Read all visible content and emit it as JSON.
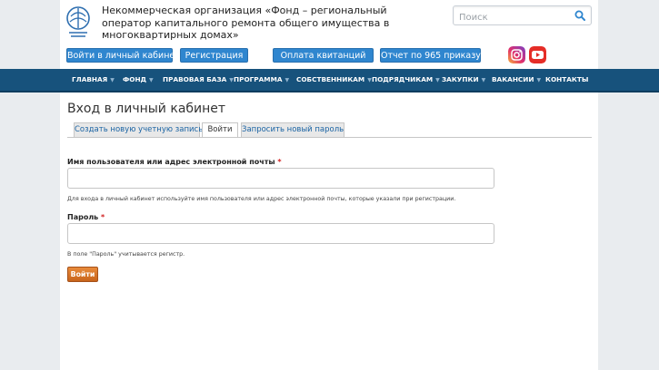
{
  "header": {
    "org_title": "Некоммерческая организация «Фонд – региональный оператор капитального ремонта общего имущества в многоквартирных домах»",
    "search_placeholder": "Поиск",
    "buttons": {
      "cabinet": "Войти в личный кабинет",
      "register": "Регистрация",
      "receipts": "Оплата квитанций",
      "report": "Отчет по 965 приказу"
    },
    "social_icons": [
      "instagram-icon",
      "youtube-icon"
    ]
  },
  "nav": {
    "items": [
      {
        "label": "ГЛАВНАЯ",
        "dropdown": true
      },
      {
        "label": "ФОНД",
        "dropdown": true
      },
      {
        "label": "ПРАВОВАЯ БАЗА",
        "dropdown": true
      },
      {
        "label": "ПРОГРАММА",
        "dropdown": true
      },
      {
        "label": "СОБСТВЕННИКАМ",
        "dropdown": true
      },
      {
        "label": "ПОДРЯДЧИКАМ",
        "dropdown": true
      },
      {
        "label": "ЗАКУПКИ",
        "dropdown": true
      },
      {
        "label": "ВАКАНСИИ",
        "dropdown": true
      },
      {
        "label": "КОНТАКТЫ",
        "dropdown": false
      }
    ]
  },
  "main": {
    "heading": "Вход в личный кабинет",
    "tabs": [
      {
        "label": "Создать новую учетную запись",
        "active": false
      },
      {
        "label": "Войти",
        "active": true
      },
      {
        "label": "Запросить новый пароль",
        "active": false
      }
    ],
    "username": {
      "label": "Имя пользователя или адрес электронной почты",
      "required_mark": "*",
      "value": "",
      "description": "Для входа в личный кабинет используйте имя пользователя или адрес электронной почты, которые указали при регистрации."
    },
    "password": {
      "label": "Пароль",
      "required_mark": "*",
      "value": "",
      "description": "В поле \"Пароль\" учитывается регистр."
    },
    "submit_label": "Войти"
  },
  "colors": {
    "nav_bg": "#17527c",
    "button_blue": "#2f86cf",
    "submit_orange": "#d9782c",
    "required_red": "#d01f1f"
  }
}
